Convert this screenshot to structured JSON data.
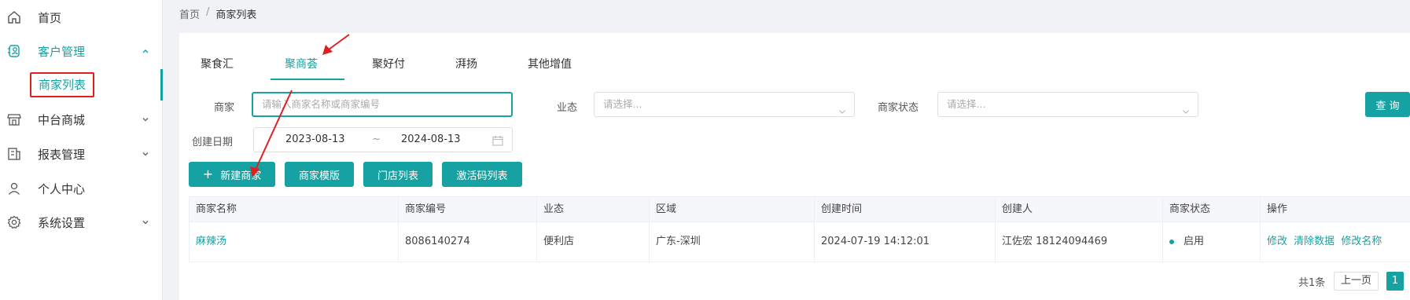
{
  "sidebar": {
    "items": [
      {
        "label": "首页",
        "icon": "home-icon"
      },
      {
        "label": "客户管理",
        "icon": "customer-icon",
        "expanded": true
      },
      {
        "label": "商家列表"
      },
      {
        "label": "中台商城",
        "icon": "store-icon"
      },
      {
        "label": "报表管理",
        "icon": "report-icon"
      },
      {
        "label": "个人中心",
        "icon": "user-icon"
      },
      {
        "label": "系统设置",
        "icon": "gear-icon"
      }
    ]
  },
  "breadcrumb": {
    "home": "首页",
    "sep": "/",
    "current": "商家列表"
  },
  "tabs": [
    "聚食汇",
    "聚商荟",
    "聚好付",
    "湃扬",
    "其他增值"
  ],
  "active_tab": 1,
  "filters": {
    "merchant_label": "商家",
    "merchant_placeholder": "请输入商家名称或商家编号",
    "format_label": "业态",
    "format_placeholder": "请选择...",
    "status_label": "商家状态",
    "status_placeholder": "请选择...",
    "date_label": "创建日期",
    "date_start": "2023-08-13",
    "date_sep": "~",
    "date_end": "2024-08-13",
    "query_label": "查 询"
  },
  "actions": {
    "new_label": "新建商家",
    "template_label": "商家模版",
    "stores_label": "门店列表",
    "codes_label": "激活码列表"
  },
  "table": {
    "headers": [
      "商家名称",
      "商家编号",
      "业态",
      "区域",
      "创建时间",
      "创建人",
      "商家状态",
      "操作"
    ],
    "rows": [
      {
        "name": "麻辣汤",
        "code": "8086140274",
        "format": "便利店",
        "region": "广东-深圳",
        "created_at": "2024-07-19 14:12:01",
        "creator": "江佐宏 18124094469",
        "status": "启用",
        "ops": [
          "修改",
          "清除数据",
          "修改名称"
        ]
      }
    ]
  },
  "pagination": {
    "total_label": "共1条",
    "prev_label": "上一页",
    "page": "1"
  },
  "colors": {
    "accent": "#16a2a2",
    "annotation_red": "#e02020"
  }
}
